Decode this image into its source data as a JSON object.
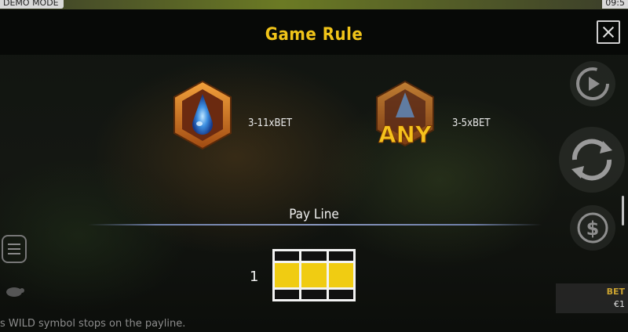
{
  "status_bar": {
    "mode": "DEMO MODE",
    "clock": "09:5"
  },
  "dialog": {
    "title": "Game Rule"
  },
  "symbols": [
    {
      "name": "blue-gem-symbol",
      "payout": "3-11xBET"
    },
    {
      "name": "any-symbol",
      "label": "ANY",
      "payout": "3-5xBET"
    }
  ],
  "payline_section": {
    "title": "Pay Line",
    "lines": [
      {
        "number": "1",
        "pattern": [
          [
            0,
            0,
            0
          ],
          [
            1,
            1,
            1
          ],
          [
            0,
            0,
            0
          ]
        ]
      }
    ]
  },
  "bet_panel": {
    "label": "BET",
    "value": "€1"
  },
  "footer_text": "s WILD symbol stops on the payline.",
  "colors": {
    "accent_gold": "#f0c419",
    "payline_fill": "#f0cc12"
  }
}
